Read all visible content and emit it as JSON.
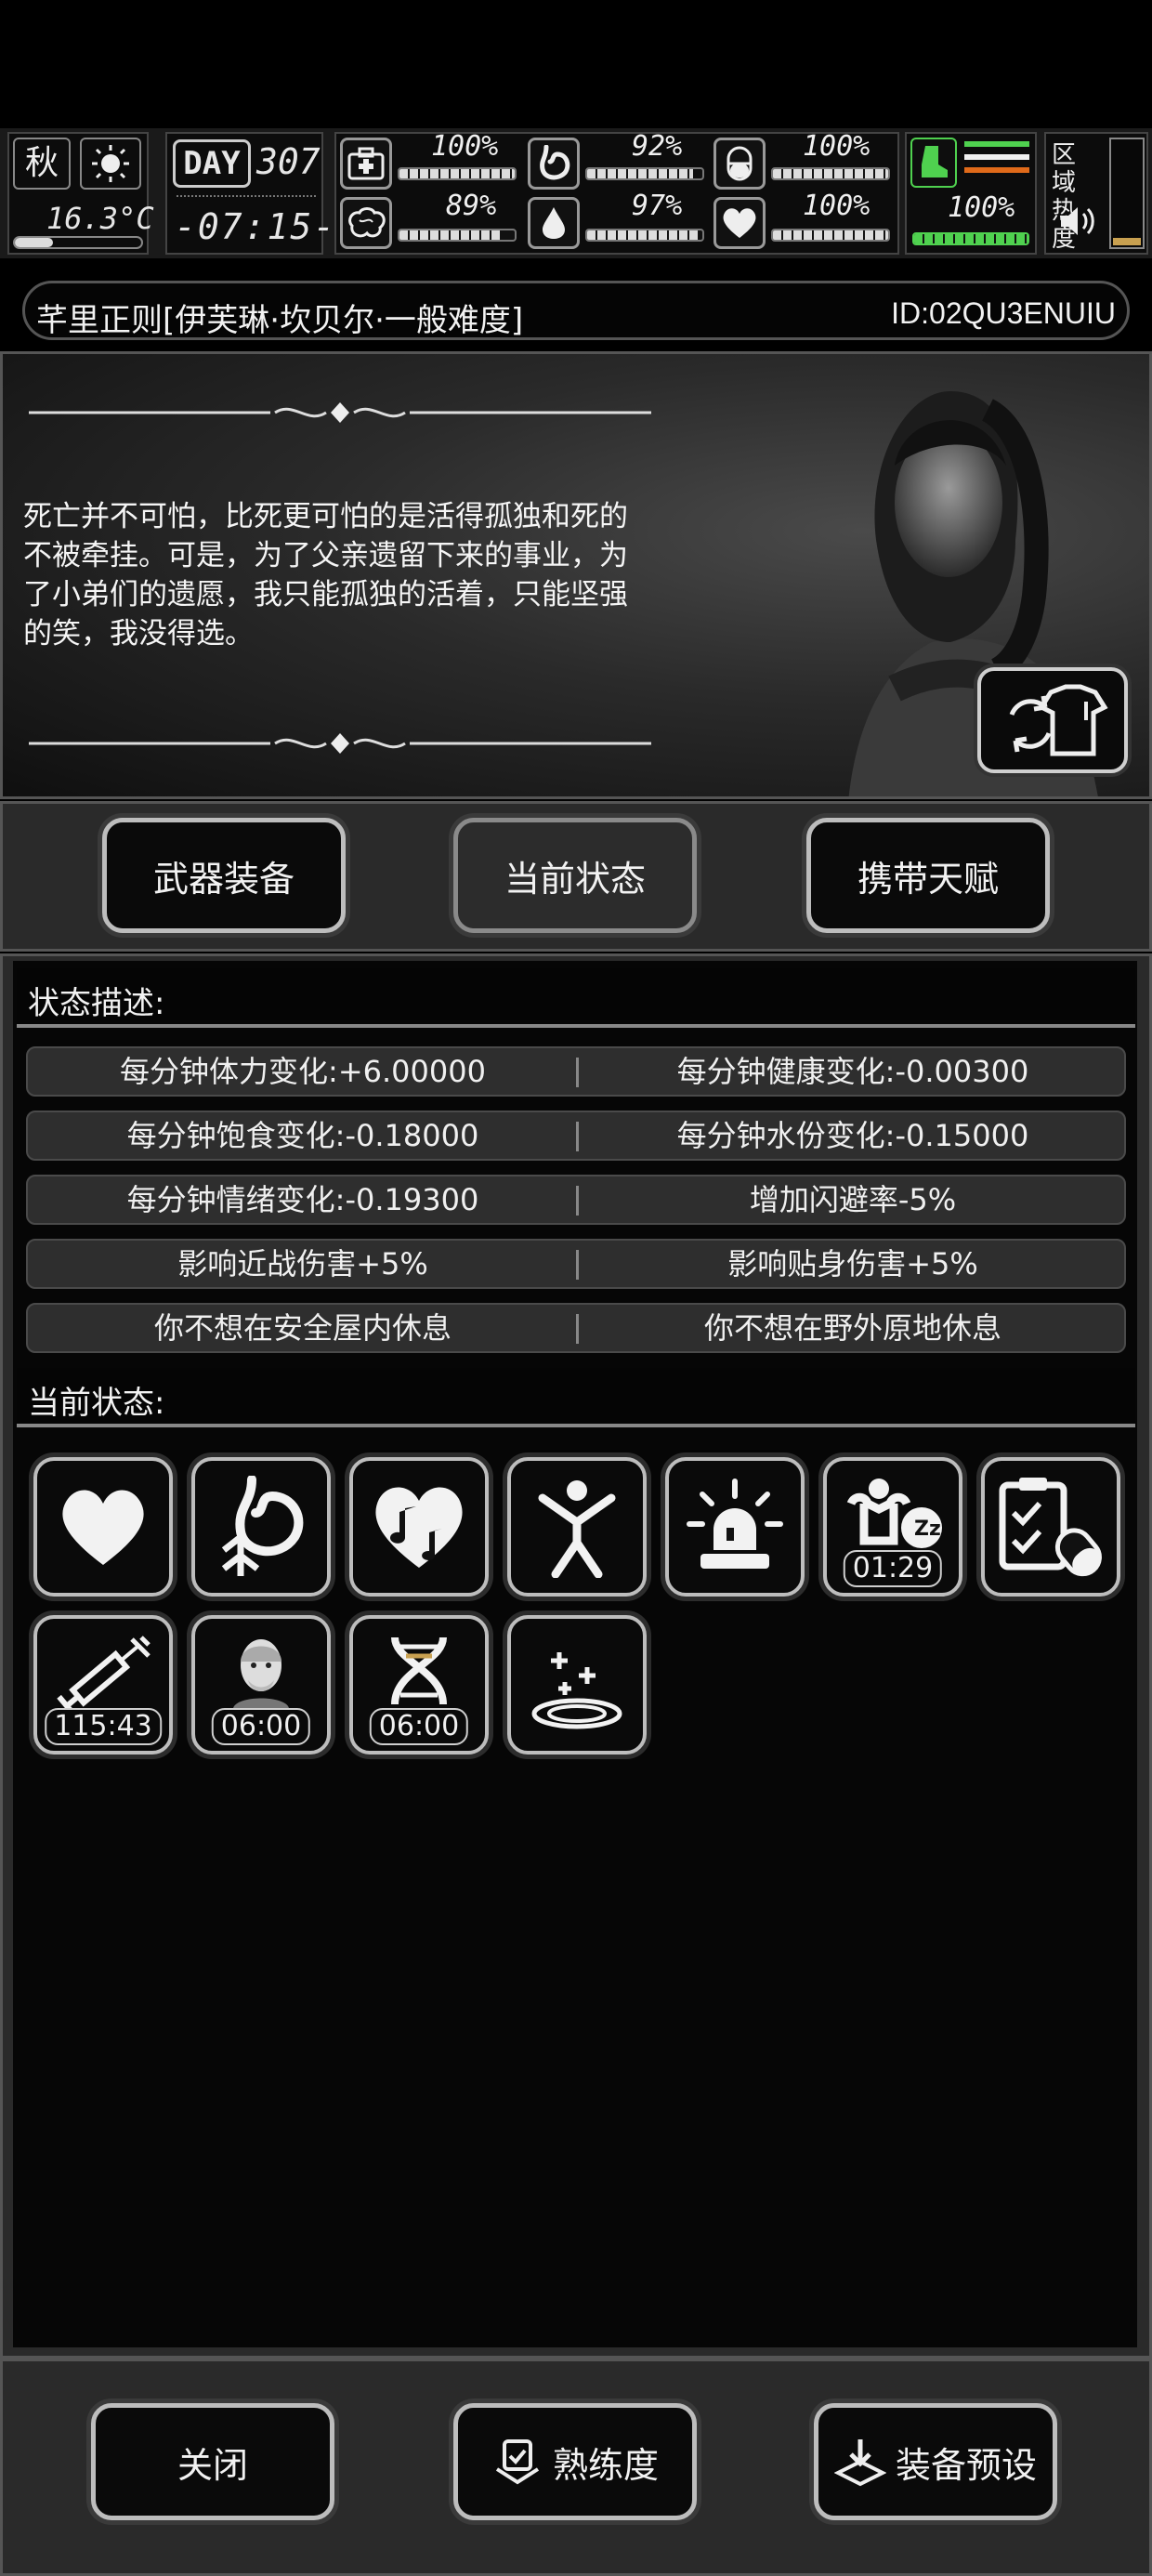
{
  "hud": {
    "season": "秋",
    "temperature": "16.3°C",
    "day_label": "DAY",
    "day_number": "307",
    "clock": "-07:15-",
    "stats": [
      {
        "name": "health",
        "icon": "medkit-icon",
        "value": "100%",
        "level": 1.0
      },
      {
        "name": "hunger",
        "icon": "stomach-icon",
        "value": "92%",
        "level": 0.92
      },
      {
        "name": "sanity",
        "icon": "capsule-icon",
        "value": "100%",
        "level": 1.0
      },
      {
        "name": "brain",
        "icon": "brain-icon",
        "value": "89%",
        "level": 0.89
      },
      {
        "name": "water",
        "icon": "water-drop-icon",
        "value": "97%",
        "level": 0.97
      },
      {
        "name": "heart",
        "icon": "heart-icon",
        "value": "100%",
        "level": 1.0
      }
    ],
    "stamina": {
      "value": "100%",
      "level": 1.0
    },
    "zone_heat_label": "区域热度"
  },
  "title": {
    "text": "芊里正则[伊芙琳·坎贝尔·一般难度]",
    "id": "ID:02QU3ENUIU"
  },
  "story": {
    "text": "死亡并不可怕，比死更可怕的是活得孤独和死的不被牵挂。可是，为了父亲遗留下来的事业，为了小弟们的遗愿，我只能孤独的活着，只能坚强的笑，我没得选。"
  },
  "tabs": [
    {
      "label": "武器装备",
      "active": false
    },
    {
      "label": "当前状态",
      "active": true
    },
    {
      "label": "携带天赋",
      "active": false
    }
  ],
  "effects": {
    "header": "状态描述:",
    "rows": [
      [
        "每分钟体力变化:+6.00000",
        "每分钟健康变化:-0.00300"
      ],
      [
        "每分钟饱食变化:-0.18000",
        "每分钟水份变化:-0.15000"
      ],
      [
        "每分钟情绪变化:-0.19300",
        "增加闪避率-5%"
      ],
      [
        "影响近战伤害+5%",
        "影响贴身伤害+5%"
      ],
      [
        "你不想在安全屋内休息",
        "你不想在野外原地休息"
      ]
    ]
  },
  "status": {
    "header": "当前状态:",
    "icons": [
      {
        "name": "heart-status-icon",
        "timer": ""
      },
      {
        "name": "stomach-status-icon",
        "timer": ""
      },
      {
        "name": "music-heart-icon",
        "timer": ""
      },
      {
        "name": "person-stretch-icon",
        "timer": ""
      },
      {
        "name": "alarm-light-icon",
        "timer": ""
      },
      {
        "name": "sleepy-strong-icon",
        "timer": "01:29"
      },
      {
        "name": "medical-clipboard-icon",
        "timer": ""
      },
      {
        "name": "syringe-icon",
        "timer": "115:43"
      },
      {
        "name": "old-man-icon",
        "timer": "06:00"
      },
      {
        "name": "dna-icon",
        "timer": "06:00"
      },
      {
        "name": "healing-area-icon",
        "timer": ""
      }
    ]
  },
  "bottom": {
    "close": "关闭",
    "proficiency": "熟练度",
    "preset": "装备预设"
  }
}
